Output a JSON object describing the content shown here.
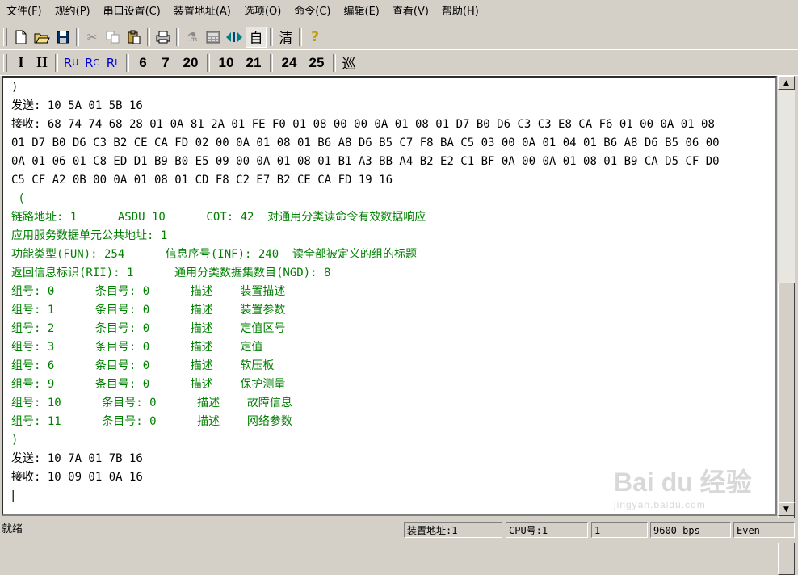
{
  "menu": [
    "文件(F)",
    "规约(P)",
    "串口设置(C)",
    "装置地址(A)",
    "选项(O)",
    "命令(C)",
    "编辑(E)",
    "查看(V)",
    "帮助(H)"
  ],
  "toolbar1": {
    "icons": [
      "new-file-icon",
      "open-folder-icon",
      "save-icon",
      "cut-icon",
      "copy-icon",
      "paste-icon",
      "print-icon",
      "tool-icon",
      "calculator-icon",
      "split-arrows-icon"
    ],
    "auto_label": "自",
    "clear_label": "清",
    "help_label": "?"
  },
  "toolbar2": {
    "level1": "I",
    "level2": "II",
    "rc_labels": [
      {
        "main": "R",
        "sub": "U"
      },
      {
        "main": "R",
        "sub": "C"
      },
      {
        "main": "R",
        "sub": "L"
      }
    ],
    "numbers": [
      "6",
      "7",
      "20",
      "10",
      "21",
      "24",
      "25"
    ],
    "patrol_label": "巡"
  },
  "log": [
    {
      "text": ")",
      "color": "black"
    },
    {
      "text": "发送: 10 5A 01 5B 16",
      "color": "black"
    },
    {
      "text": "接收: 68 74 74 68 28 01 0A 81 2A 01 FE F0 01 08 00 00 0A 01 08 01 D7 B0 D6 C3 C3 E8 CA F6 01 00 0A 01 08",
      "color": "black"
    },
    {
      "text": "01 D7 B0 D6 C3 B2 CE CA FD 02 00 0A 01 08 01 B6 A8 D6 B5 C7 F8 BA C5 03 00 0A 01 04 01 B6 A8 D6 B5 06 00",
      "color": "black"
    },
    {
      "text": "0A 01 06 01 C8 ED D1 B9 B0 E5 09 00 0A 01 08 01 B1 A3 BB A4 B2 E2 C1 BF 0A 00 0A 01 08 01 B9 CA D5 CF D0",
      "color": "black"
    },
    {
      "text": "C5 CF A2 0B 00 0A 01 08 01 CD F8 C2 E7 B2 CE CA FD 19 16",
      "color": "black"
    },
    {
      "text": " (",
      "color": "green"
    },
    {
      "text": "链路地址: 1      ASDU 10      COT: 42  对通用分类读命令有效数据响应",
      "color": "green"
    },
    {
      "text": "应用服务数据单元公共地址: 1",
      "color": "green"
    },
    {
      "text": "功能类型(FUN): 254      信息序号(INF): 240  读全部被定义的组的标题",
      "color": "green"
    },
    {
      "text": "返回信息标识(RII): 1      通用分类数据集数目(NGD): 8",
      "color": "green"
    },
    {
      "text": "组号: 0      条目号: 0      描述    装置描述",
      "color": "green"
    },
    {
      "text": "组号: 1      条目号: 0      描述    装置参数",
      "color": "green"
    },
    {
      "text": "组号: 2      条目号: 0      描述    定值区号",
      "color": "green"
    },
    {
      "text": "组号: 3      条目号: 0      描述    定值",
      "color": "green"
    },
    {
      "text": "组号: 6      条目号: 0      描述    软压板",
      "color": "green"
    },
    {
      "text": "组号: 9      条目号: 0      描述    保护测量",
      "color": "green"
    },
    {
      "text": "组号: 10      条目号: 0      描述    故障信息",
      "color": "green"
    },
    {
      "text": "组号: 11      条目号: 0      描述    网络参数",
      "color": "green"
    },
    {
      "text": ")",
      "color": "green"
    },
    {
      "text": "发送: 10 7A 01 7B 16",
      "color": "black"
    },
    {
      "text": "接收: 10 09 01 0A 16",
      "color": "black"
    },
    {
      "text": "|",
      "color": "black"
    }
  ],
  "status": {
    "ready": "就绪",
    "device_address": "装置地址:1",
    "cpu": "CPU号:1",
    "num": "1",
    "baud": "9600 bps",
    "parity": "Even"
  },
  "watermark": {
    "main": "Bai du 经验",
    "sub": "jingyan.baidu.com"
  }
}
